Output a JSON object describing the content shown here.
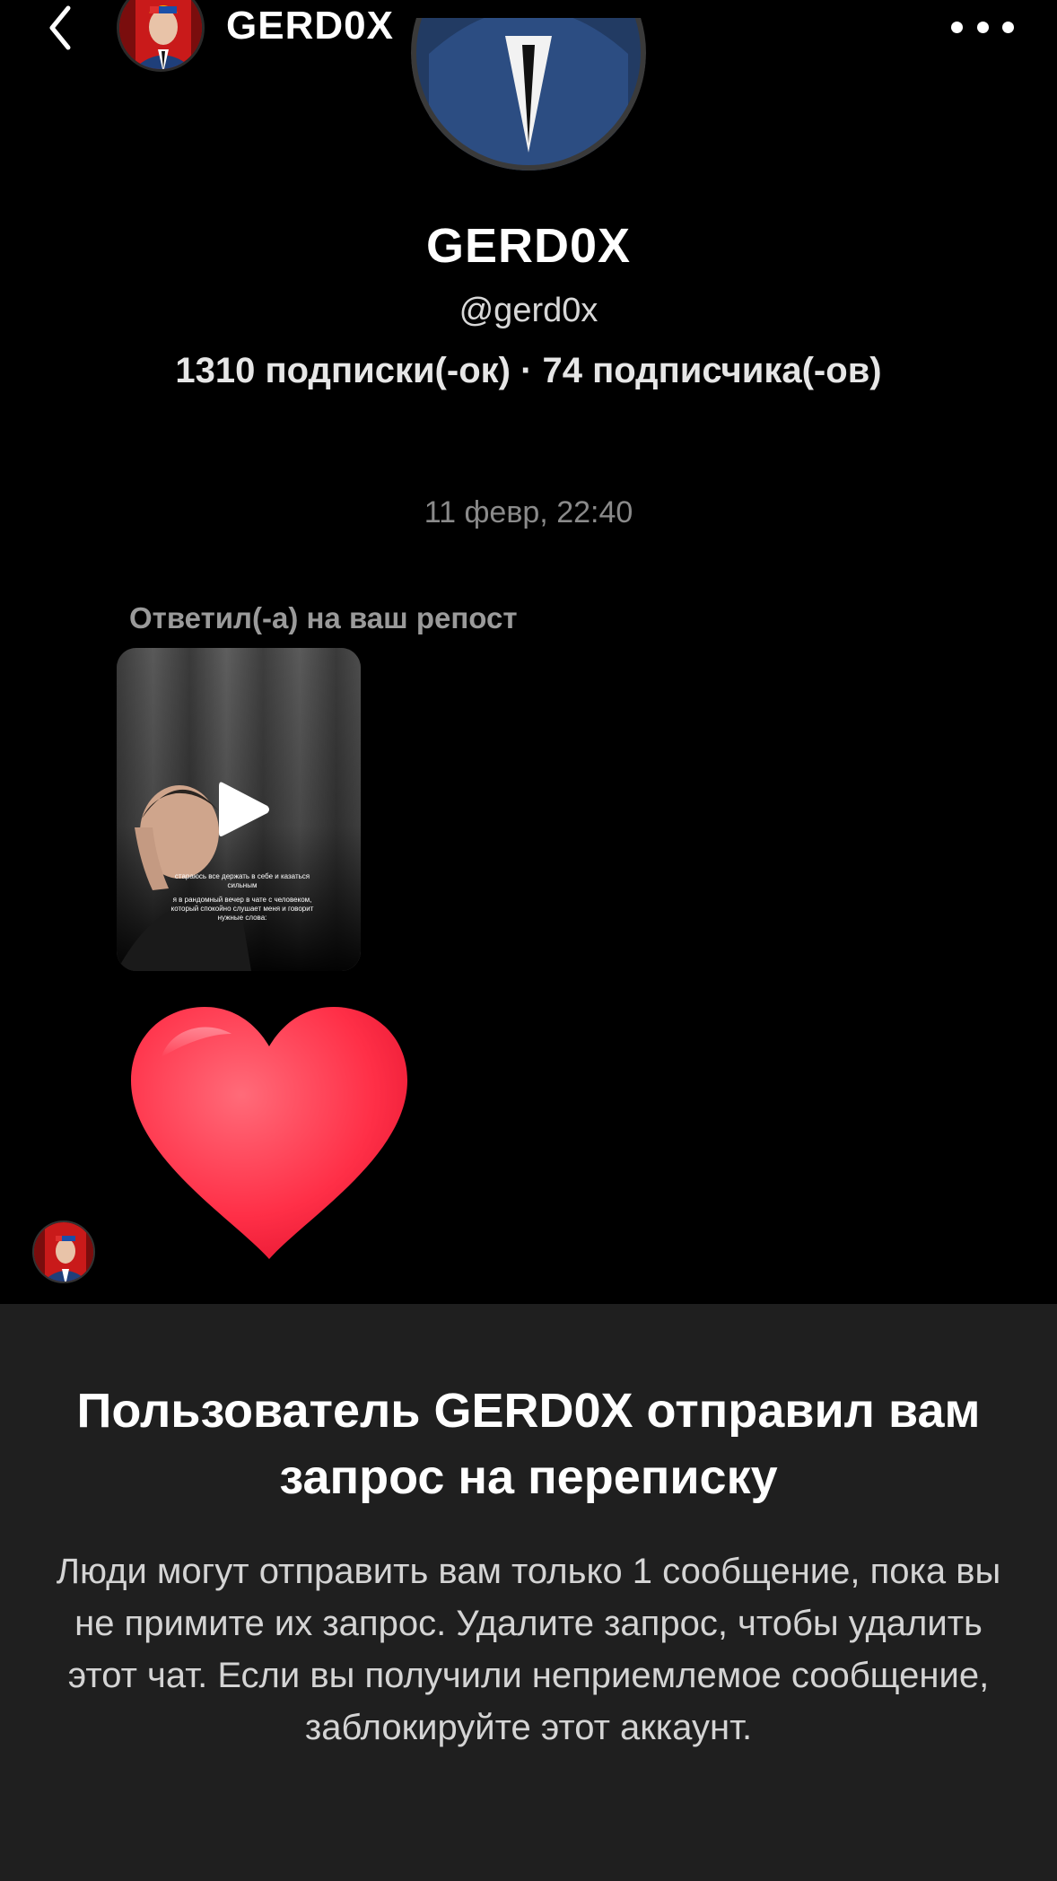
{
  "header": {
    "back_icon": "chevron-left-icon",
    "title": "GERD0X",
    "more_icon": "ellipsis-icon"
  },
  "profile": {
    "name": "GERD0X",
    "handle": "@gerd0x",
    "stats": "1310 подписки(-ок) · 74 подписчика(-ов)"
  },
  "conversation": {
    "timestamp": "11 февр, 22:40",
    "reply_label": "Ответил(-а) на ваш репост",
    "video_overlay_line1": "стараюсь все держать в себе и казаться сильным",
    "video_overlay_line2": "я в рандомный вечер в чате с человеком, который спокойно слушает меня и говорит нужные слова:",
    "reaction": "heart-icon"
  },
  "request_sheet": {
    "title": "Пользователь GERD0X отправил вам запрос на переписку",
    "body": "Люди могут отправить вам только 1 сообщение, пока вы не примите их запрос. Удалите запрос, чтобы удалить этот чат. Если вы получили неприемлемое сообщение, заблокируйте этот аккаунт."
  },
  "colors": {
    "background": "#000000",
    "sheet": "#1f1f1f",
    "heart": "#ff3b4e",
    "muted_text": "#8a8a8a"
  }
}
